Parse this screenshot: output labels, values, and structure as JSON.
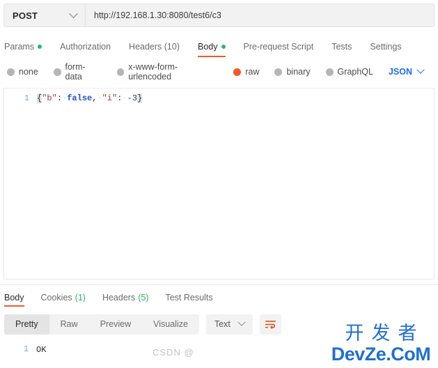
{
  "request": {
    "method": "POST",
    "method_caret_icon": "chevron-down-icon",
    "url": "http://192.168.1.30:8080/test6/c3",
    "url_placeholder": "Enter request URL",
    "tabs": [
      {
        "label": "Params",
        "dot": true,
        "active": false
      },
      {
        "label": "Authorization",
        "dot": false,
        "active": false
      },
      {
        "label": "Headers (10)",
        "dot": false,
        "active": false
      },
      {
        "label": "Body",
        "dot": true,
        "active": true
      },
      {
        "label": "Pre-request Script",
        "dot": false,
        "active": false
      },
      {
        "label": "Tests",
        "dot": false,
        "active": false
      },
      {
        "label": "Settings",
        "dot": false,
        "active": false
      }
    ],
    "body_types": [
      {
        "label": "none",
        "selected": false
      },
      {
        "label": "form-data",
        "selected": false
      },
      {
        "label": "x-www-form-urlencoded",
        "selected": false
      },
      {
        "label": "raw",
        "selected": true
      },
      {
        "label": "binary",
        "selected": false
      },
      {
        "label": "GraphQL",
        "selected": false
      }
    ],
    "raw_format": "JSON",
    "raw_format_caret_icon": "chevron-down-icon",
    "editor": {
      "line_number": "1",
      "tokens": {
        "open_brace": "{",
        "key_b": "\"b\"",
        "colon1": ":",
        "space1": "·",
        "value_false": "false",
        "comma": ",",
        "space2": "·",
        "key_i": "\"i\"",
        "colon2": ":",
        "space3": "·",
        "value_num": "-3",
        "close_brace": "}"
      },
      "raw_text": "{\"b\": false, \"i\": -3}"
    }
  },
  "response": {
    "tabs": [
      {
        "label": "Body",
        "count": "",
        "active": true
      },
      {
        "label": "Cookies",
        "count": "(1)",
        "active": false
      },
      {
        "label": "Headers",
        "count": "(5)",
        "active": false
      },
      {
        "label": "Test Results",
        "count": "",
        "active": false
      }
    ],
    "view_modes": [
      {
        "label": "Pretty",
        "active": true
      },
      {
        "label": "Raw",
        "active": false
      },
      {
        "label": "Preview",
        "active": false
      },
      {
        "label": "Visualize",
        "active": false
      }
    ],
    "format": "Text",
    "format_caret_icon": "chevron-down-icon",
    "wrap_icon": "wrap-lines-icon",
    "body": {
      "line_number": "1",
      "text": "OK"
    }
  },
  "watermarks": {
    "csdn": "CSDN @",
    "cn": "开发者",
    "en": "DevZe.CoM"
  },
  "colors": {
    "accent_orange": "#ef5b25",
    "raw_selected": "#f1592a",
    "dot_green": "#29b866",
    "link_blue": "#1b6ff0",
    "watermark_blue": "#1f6fd0"
  }
}
